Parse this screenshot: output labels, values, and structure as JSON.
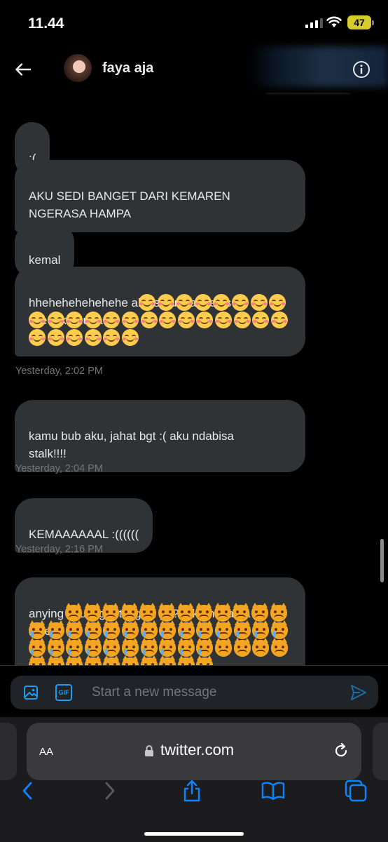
{
  "status_bar": {
    "time": "11.44",
    "battery": "47"
  },
  "header": {
    "contact_name": "faya aja"
  },
  "messages": [
    {
      "text": ":("
    },
    {
      "text": "AKU SEDI BANGET DARI KEMAREN\nNGERASA HAMPA"
    },
    {
      "text": "kemal"
    },
    {
      "text": "hhehehehehehehe aku suru joanne ss in\ntweet kamu tadi",
      "emoji_icon": "smiling-face-with-smiling-eyes",
      "emoji_rows": [
        8,
        14,
        6
      ]
    },
    {
      "text": "kamu bub aku, jahat bgt :( aku ndabisa\nstalk!!!!"
    },
    {
      "text": "KEMAAAAAAL :(((((("
    },
    {
      "text": "anying aku logout lagi ni ya??! kamu lama\nbales",
      "emoji_icon": "pouting-cat-and-crying-cat"
    }
  ],
  "timestamps": [
    "Yesterday, 2:02 PM",
    "Yesterday, 2:04 PM",
    "Yesterday, 2:16 PM"
  ],
  "composer": {
    "placeholder": "Start a new message"
  },
  "safari": {
    "aa_label": "AA",
    "url": "twitter.com"
  },
  "colors": {
    "accent": "#1d9bf0",
    "bubble": "#2f3336",
    "battery": "#d6cd2c"
  }
}
